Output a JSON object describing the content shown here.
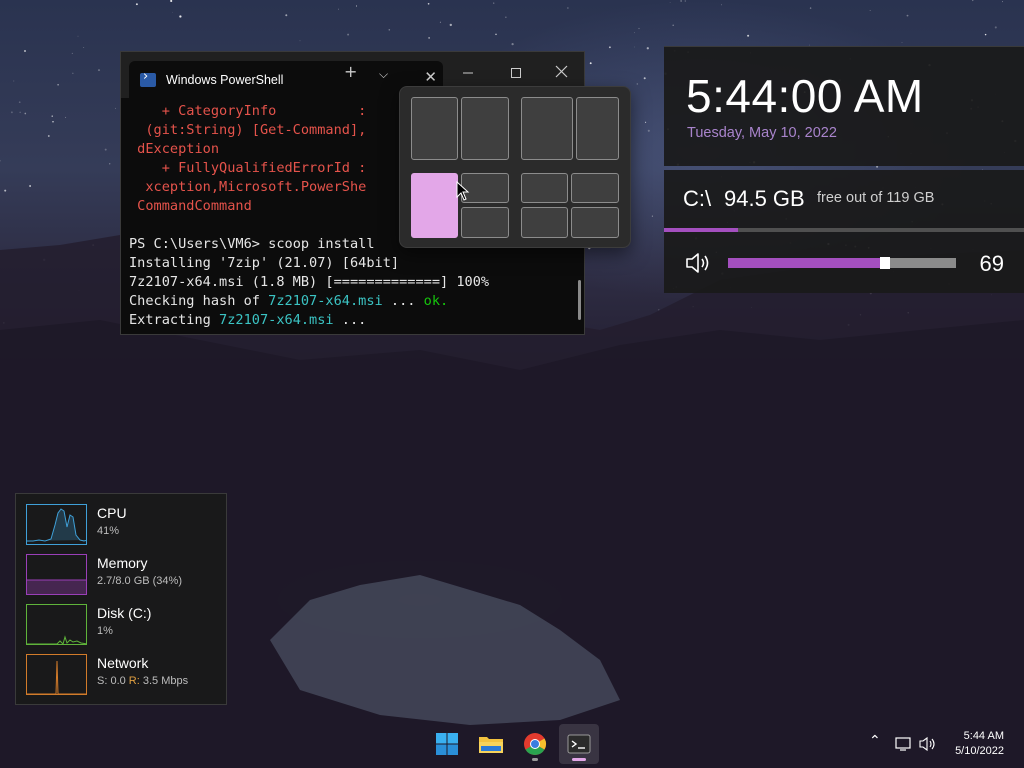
{
  "terminal": {
    "tab_title": "Windows PowerShell",
    "lines": [
      {
        "parts": [
          {
            "t": "    + CategoryInfo          : ",
            "c": "err"
          }
        ]
      },
      {
        "parts": [
          {
            "t": "  (git:String) [Get-Command],",
            "c": "err"
          }
        ]
      },
      {
        "parts": [
          {
            "t": " dException",
            "c": "err"
          }
        ]
      },
      {
        "parts": [
          {
            "t": "    + FullyQualifiedErrorId : ",
            "c": "err"
          }
        ]
      },
      {
        "parts": [
          {
            "t": "  xception,Microsoft.PowerShe",
            "c": "err"
          }
        ]
      },
      {
        "parts": [
          {
            "t": " CommandCommand",
            "c": "err"
          }
        ]
      },
      {
        "parts": [
          {
            "t": "",
            "c": "fg"
          }
        ]
      },
      {
        "parts": [
          {
            "t": "PS C:\\Users\\VM6> ",
            "c": "fg"
          },
          {
            "t": "scoop install ",
            "c": "fg"
          }
        ]
      },
      {
        "parts": [
          {
            "t": "Installing '7zip' (21.07) [64bit]",
            "c": "fg"
          }
        ]
      },
      {
        "parts": [
          {
            "t": "7z2107-x64.msi (1.8 MB) [=============] 100%",
            "c": "fg"
          }
        ]
      },
      {
        "parts": [
          {
            "t": "Checking hash of ",
            "c": "fg"
          },
          {
            "t": "7z2107-x64.msi",
            "c": "cyan"
          },
          {
            "t": " ... ",
            "c": "fg"
          },
          {
            "t": "ok.",
            "c": "green"
          }
        ]
      },
      {
        "parts": [
          {
            "t": "Extracting ",
            "c": "fg"
          },
          {
            "t": "7z2107-x64.msi",
            "c": "cyan"
          },
          {
            "t": " ...",
            "c": "fg"
          }
        ]
      }
    ]
  },
  "clock": {
    "time": "5:44:00 AM",
    "date": "Tuesday, May 10, 2022"
  },
  "disk": {
    "drive": "C:\\",
    "free": "94.5 GB",
    "total": "free out of 119 GB",
    "used_fraction": 0.206
  },
  "volume": {
    "value": "69",
    "level": 0.69
  },
  "performance": [
    {
      "label": "CPU",
      "value": "41%",
      "color": "#3fa0d8"
    },
    {
      "label": "Memory",
      "value": "2.7/8.0 GB (34%)",
      "color": "#9a3fb8"
    },
    {
      "label": "Disk (C:)",
      "value": "1%",
      "color": "#5fb43a"
    },
    {
      "label": "Network",
      "value_s": "S: 0.0 ",
      "value_r_prefix": "R:",
      "value_r": " 3.5 Mbps",
      "color": "#d27b2a"
    }
  ],
  "taskbar": {
    "apps": [
      {
        "name": "start-button-icon"
      },
      {
        "name": "file-explorer-icon"
      },
      {
        "name": "chrome-icon"
      },
      {
        "name": "terminal-icon"
      }
    ],
    "time": "5:44 AM",
    "date": "5/10/2022"
  },
  "colors": {
    "accent": "#a44fbf",
    "snap_active": "#e3a7e8",
    "date_text": "#a984cc"
  }
}
